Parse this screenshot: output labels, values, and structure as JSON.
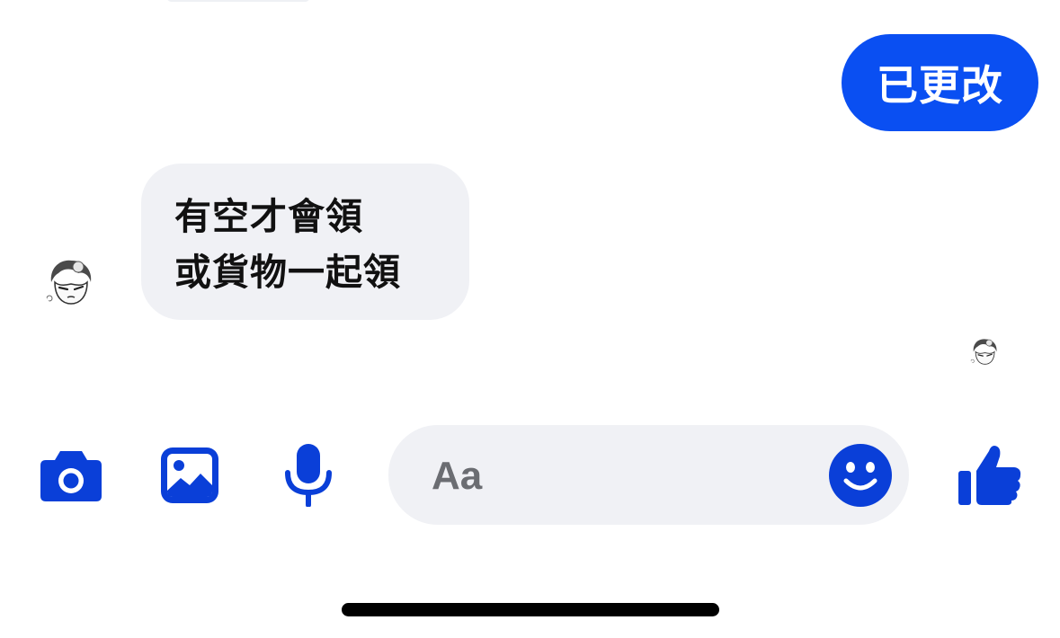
{
  "thread": {
    "messages": [
      {
        "direction": "outgoing",
        "lines": [
          "已更改"
        ]
      },
      {
        "direction": "incoming",
        "lines": [
          "有空才會領",
          "或貨物一起領"
        ]
      }
    ]
  },
  "composer": {
    "placeholder": "Aa"
  },
  "icons": {
    "camera": "camera-icon",
    "gallery": "image-icon",
    "mic": "microphone-icon",
    "emoji": "smiley-icon",
    "like": "thumbs-up-icon"
  },
  "colors": {
    "accent": "#0a4ff2",
    "icon_blue": "#0a3fd8",
    "incoming_bubble": "#f0f1f5",
    "outgoing_text": "#ffffff"
  }
}
